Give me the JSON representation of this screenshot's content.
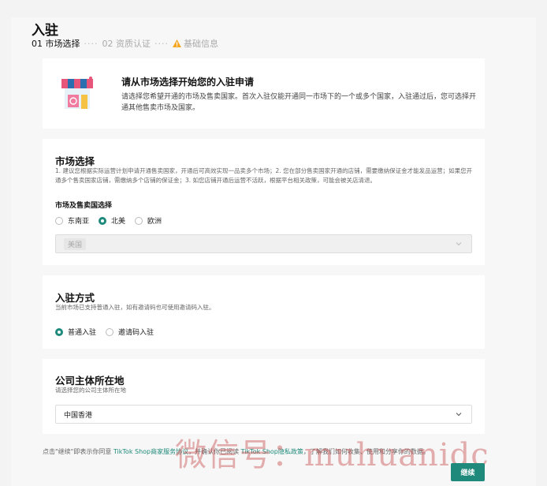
{
  "header": {
    "title": "入驻",
    "steps": [
      {
        "label": "01 市场选择"
      },
      {
        "label": "02 资质认证"
      },
      {
        "label": "基础信息"
      }
    ]
  },
  "intro": {
    "title": "请从市场选择开始您的入驻申请",
    "desc": "请选择您希望开通的市场及售卖国家。首次入驻仅能开通同一市场下的一个或多个国家，入驻通过后，您可选择开通其他售卖市场及国家。"
  },
  "market": {
    "title": "市场选择",
    "desc": "1. 建议您根据实际运营计划申请开通售卖国家，开通后可高效实现一品卖多个市场；2. 您在部分售卖国家开通的店铺，需要缴纳保证金才能发品运营；如果您开通多个售卖国家店铺，需缴纳多个店铺的保证金；3. 如您店铺开通后运营不活跃，根据平台相关政策，可能会被关店清退。",
    "sub_label": "市场及售卖国选择",
    "options": [
      "东南亚",
      "北美",
      "欧洲"
    ],
    "selected": "北美",
    "country_chip": "美国"
  },
  "method": {
    "title": "入驻方式",
    "desc": "当前市场已支持普通入驻，如有邀请码也可使用邀请码入驻。",
    "options": [
      "普通入驻",
      "邀请码入驻"
    ],
    "selected": "普通入驻"
  },
  "company": {
    "title": "公司主体所在地",
    "desc": "请选择您的公司主体所在地",
    "value": "中国香港"
  },
  "footer": {
    "prefix": "点击\"继续\"即表示你同意 ",
    "link1": "TikTok Shop商家服务协议",
    "middle": "，并确认你已阅读 ",
    "link2": "TikTok Shop隐私政策",
    "suffix": "，了解我们如何收集、使用和分享你的数据。"
  },
  "watermark": "微信号：muhuanidc",
  "actions": {
    "continue": "继续"
  },
  "colors": {
    "accent": "#1f8a7b",
    "warning": "#f5a623"
  }
}
